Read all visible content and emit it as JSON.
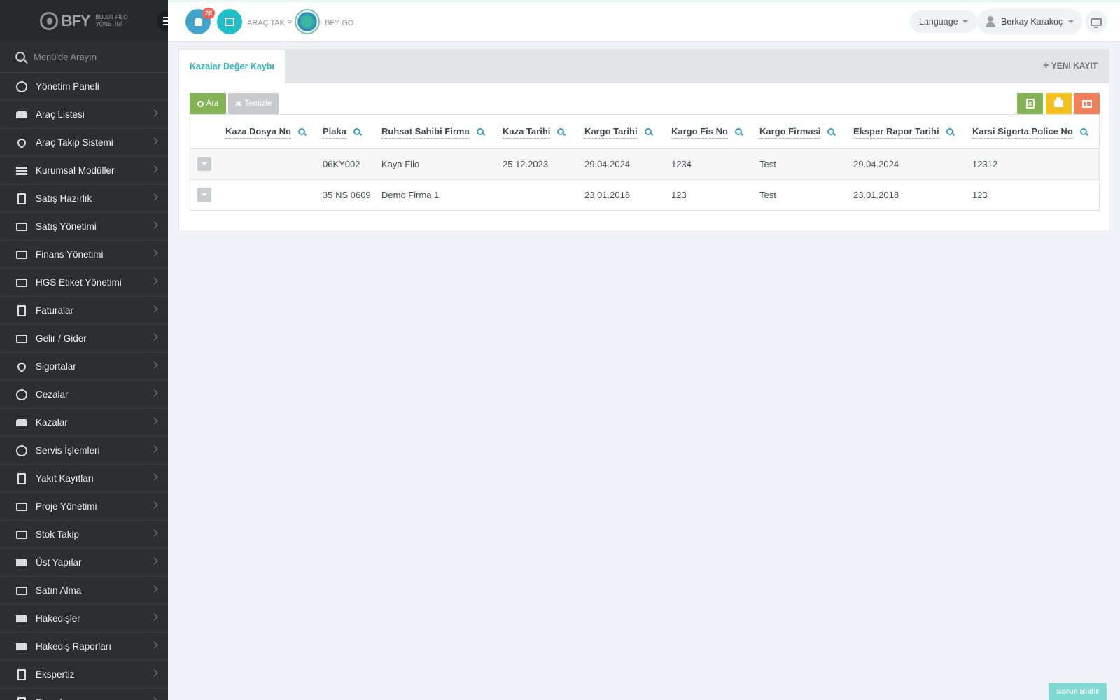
{
  "brand": {
    "name": "BFY",
    "subtitle_line1": "BULUT FİLO",
    "subtitle_line2": "YÖNETİMİ"
  },
  "sidebar": {
    "search_placeholder": "Menü'de Arayın",
    "items": [
      {
        "label": "Yönetim Paneli",
        "icon": "dashboard-icon"
      },
      {
        "label": "Araç Listesi",
        "icon": "car-icon"
      },
      {
        "label": "Araç Takip Sistemi",
        "icon": "map-pin-icon"
      },
      {
        "label": "Kurumsal Modüller",
        "icon": "server-icon"
      },
      {
        "label": "Satış Hazırlık",
        "icon": "book-icon"
      },
      {
        "label": "Satış Yönetimi",
        "icon": "credit-card-icon"
      },
      {
        "label": "Finans Yönetimi",
        "icon": "money-icon"
      },
      {
        "label": "HGS Etiket Yönetimi",
        "icon": "ticket-icon"
      },
      {
        "label": "Faturalar",
        "icon": "file-icon"
      },
      {
        "label": "Gelir / Gider",
        "icon": "money-icon"
      },
      {
        "label": "Sigortalar",
        "icon": "umbrella-icon"
      },
      {
        "label": "Cezalar",
        "icon": "times-circle-icon"
      },
      {
        "label": "Kazalar",
        "icon": "car-crash-icon"
      },
      {
        "label": "Servis İşlemleri",
        "icon": "check-circle-icon"
      },
      {
        "label": "Yakıt Kayıtları",
        "icon": "fuel-icon"
      },
      {
        "label": "Proje Yönetimi",
        "icon": "briefcase-icon"
      },
      {
        "label": "Stok Takip",
        "icon": "inbox-icon"
      },
      {
        "label": "Üst Yapılar",
        "icon": "truck-icon"
      },
      {
        "label": "Satın Alma",
        "icon": "credit-card-icon"
      },
      {
        "label": "Hakedişler",
        "icon": "truck-icon"
      },
      {
        "label": "Hakediş Raporları",
        "icon": "truck-icon"
      },
      {
        "label": "Ekspertiz",
        "icon": "list-icon"
      },
      {
        "label": "Firmalar",
        "icon": "building-icon"
      }
    ]
  },
  "topbar": {
    "notification_count": "28",
    "arac_takip": "ARAÇ TAKİP",
    "bfy_go": "BFY GO",
    "language": "Language",
    "user_name": "Berkay Karakoç"
  },
  "panel": {
    "tab_label": "Kazalar Değer Kaybı",
    "new_record": "YENİ KAYIT",
    "search_button": "Ara",
    "clear_button": "Temizle",
    "excel_glyph": "X"
  },
  "table": {
    "columns": [
      "Kaza Dosya No",
      "Plaka",
      "Ruhsat Sahibi Firma",
      "Kaza Tarihi",
      "Kargo Tarihi",
      "Kargo Fis No",
      "Kargo Firmasi",
      "Eksper Rapor Tarihi",
      "Karsi Sigorta Police No"
    ],
    "rows": [
      [
        "",
        "06KY002",
        "Kaya Filo",
        "25.12.2023",
        "29.04.2024",
        "1234",
        "Test",
        "29.04.2024",
        "12312"
      ],
      [
        "",
        "35 NS 0609",
        "Demo Firma 1",
        "",
        "23.01.2018",
        "123",
        "Test",
        "23.01.2018",
        "123"
      ]
    ]
  },
  "footer": {
    "report_issue": "Sorun Bildir"
  },
  "colors": {
    "accent": "#2bb1b8",
    "sidebar_bg": "#2b2f31",
    "search_green": "#85b456",
    "print_yellow": "#f4c01e",
    "grid_orange": "#f07f5a"
  }
}
